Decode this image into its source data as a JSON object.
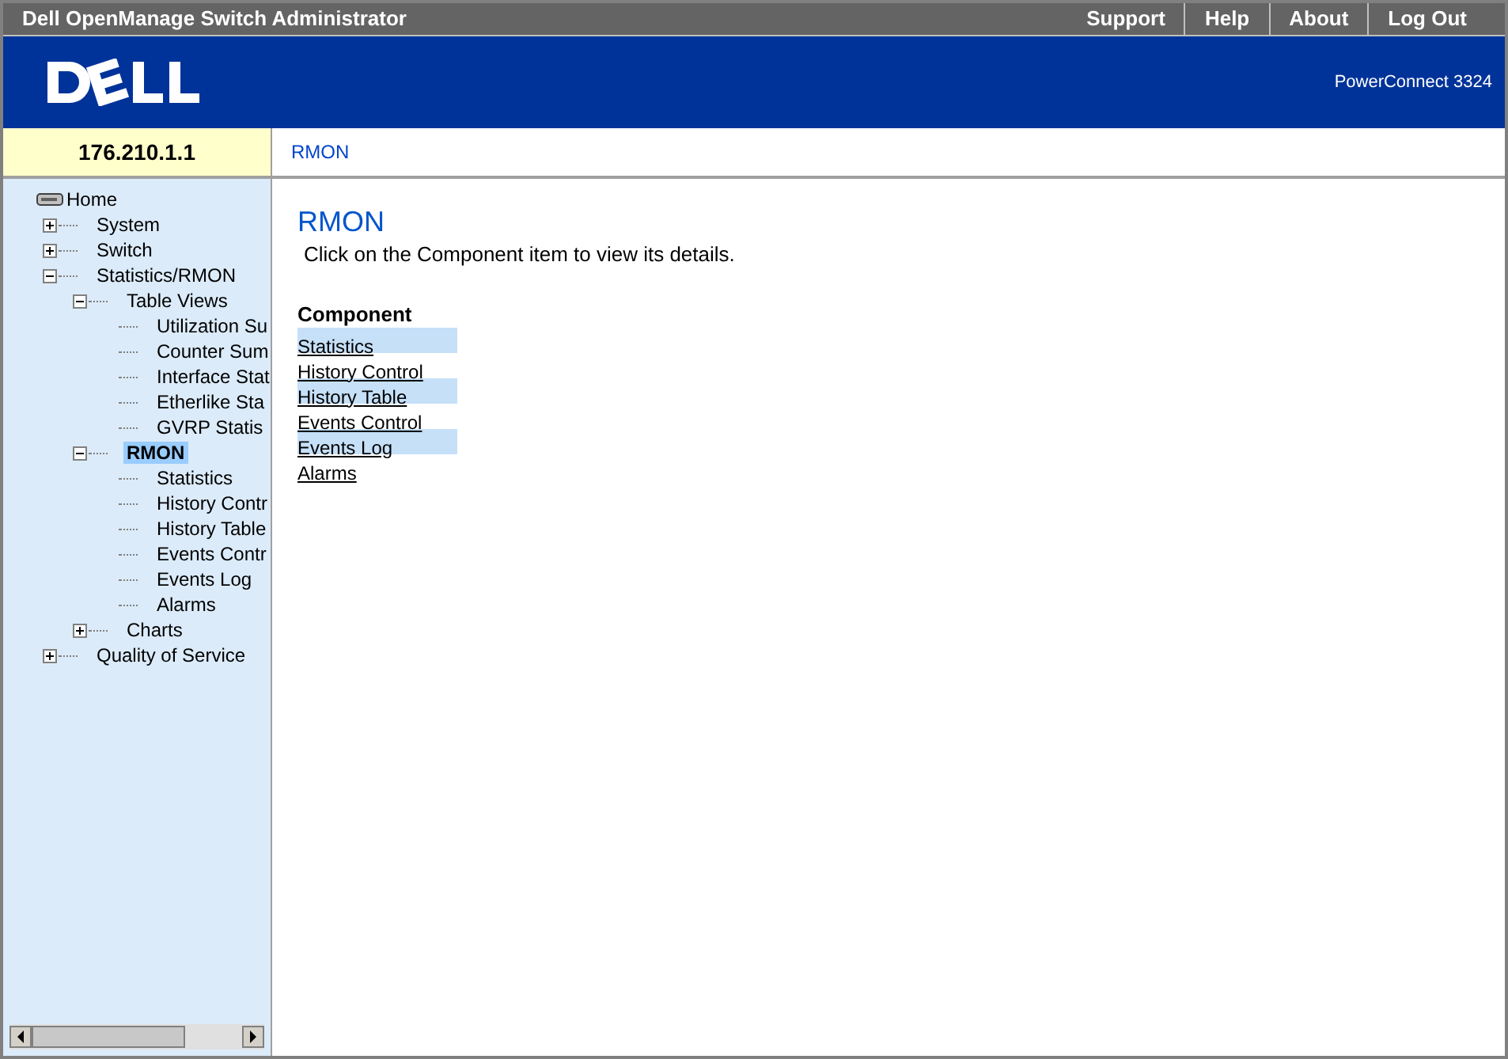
{
  "title_bar": {
    "title": "Dell OpenManage Switch Administrator",
    "links": [
      "Support",
      "Help",
      "About",
      "Log Out"
    ]
  },
  "banner": {
    "model": "PowerConnect 3324"
  },
  "address": "176.210.1.1",
  "breadcrumb": "RMON",
  "tree": [
    {
      "label": "Home",
      "kind": "root",
      "selected": false,
      "children": [
        {
          "label": "System",
          "kind": "folder",
          "expanded": false,
          "selected": false
        },
        {
          "label": "Switch",
          "kind": "folder",
          "expanded": false,
          "selected": false
        },
        {
          "label": "Statistics/RMON",
          "kind": "folder",
          "expanded": true,
          "selected": false,
          "children": [
            {
              "label": "Table Views",
              "kind": "folder",
              "expanded": true,
              "selected": false,
              "children": [
                {
                  "label": "Utilization Su",
                  "kind": "leaf",
                  "selected": false
                },
                {
                  "label": "Counter Sum",
                  "kind": "leaf",
                  "selected": false
                },
                {
                  "label": "Interface Stat",
                  "kind": "leaf",
                  "selected": false
                },
                {
                  "label": "Etherlike Sta",
                  "kind": "leaf",
                  "selected": false
                },
                {
                  "label": "GVRP Statis",
                  "kind": "leaf",
                  "selected": false
                }
              ]
            },
            {
              "label": "RMON",
              "kind": "folder",
              "expanded": true,
              "selected": true,
              "children": [
                {
                  "label": "Statistics",
                  "kind": "leaf",
                  "selected": false
                },
                {
                  "label": "History Contr",
                  "kind": "leaf",
                  "selected": false
                },
                {
                  "label": "History Table",
                  "kind": "leaf",
                  "selected": false
                },
                {
                  "label": "Events Contr",
                  "kind": "leaf",
                  "selected": false
                },
                {
                  "label": "Events Log",
                  "kind": "leaf",
                  "selected": false
                },
                {
                  "label": "Alarms",
                  "kind": "leaf",
                  "selected": false
                }
              ]
            },
            {
              "label": "Charts",
              "kind": "folder",
              "expanded": false,
              "selected": false
            }
          ]
        },
        {
          "label": "Quality of Service",
          "kind": "folder",
          "expanded": false,
          "selected": false
        }
      ]
    }
  ],
  "content": {
    "heading": "RMON",
    "intro": "Click on the Component item to view its details.",
    "table_header": "Component",
    "components": [
      "Statistics",
      "History Control",
      "History Table",
      "Events Control",
      "Events Log",
      "Alarms"
    ]
  }
}
